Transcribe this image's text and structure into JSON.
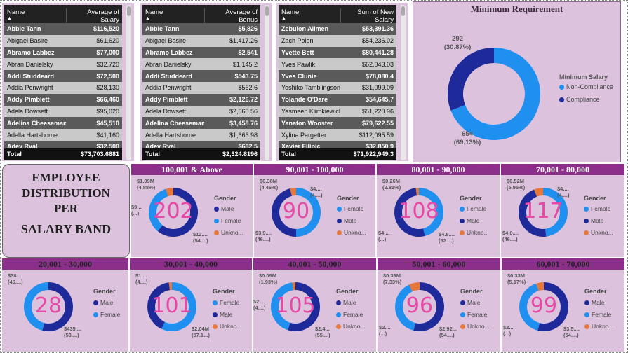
{
  "colors": {
    "male": "#1e2a9a",
    "female": "#1f8ff0",
    "unknown": "#e8773a",
    "compliance": "#1e2a9a",
    "noncompliance": "#1f8ff0"
  },
  "tables": [
    {
      "col1": "Name",
      "col2": "Average of Salary",
      "total_label": "Total",
      "total": "$73,703.6681",
      "rows": [
        [
          "Abbie Tann",
          "$116,520"
        ],
        [
          "Abigael Basire",
          "$61,620"
        ],
        [
          "Abramo Labbez",
          "$77,000"
        ],
        [
          "Abran Danielsky",
          "$32,720"
        ],
        [
          "Addi Studdeard",
          "$72,500"
        ],
        [
          "Addia Penwright",
          "$28,130"
        ],
        [
          "Addy Pimblett",
          "$66,460"
        ],
        [
          "Adela Dowsett",
          "$95,020"
        ],
        [
          "Adelina Cheeseman",
          "$45,510"
        ],
        [
          "Adella Hartshorne",
          "$41,160"
        ],
        [
          "Adey Ryal",
          "$32,500"
        ]
      ]
    },
    {
      "col1": "Name",
      "col2": "Average of Bonus",
      "total_label": "Total",
      "total": "$2,324.8196",
      "rows": [
        [
          "Abbie Tann",
          "$5,826"
        ],
        [
          "Abigael Basire",
          "$1,417.26"
        ],
        [
          "Abramo Labbez",
          "$2,541"
        ],
        [
          "Abran Danielsky",
          "$1,145.2"
        ],
        [
          "Addi Studdeard",
          "$543.75"
        ],
        [
          "Addia Penwright",
          "$562.6"
        ],
        [
          "Addy Pimblett",
          "$2,126.72"
        ],
        [
          "Adela Dowsett",
          "$2,660.56"
        ],
        [
          "Adelina Cheeseman",
          "$3,458.76"
        ],
        [
          "Adella Hartshorne",
          "$1,666.98"
        ],
        [
          "Adey Ryal",
          "$682.5"
        ]
      ]
    },
    {
      "col1": "Name",
      "col2": "Sum of New Salary",
      "total_label": "Total",
      "total": "$71,922,949.3",
      "rows": [
        [
          "Zebulon Allmen",
          "$53,391.36"
        ],
        [
          "Zach Polon",
          "$54,236.02"
        ],
        [
          "Yvette Bett",
          "$80,441.28"
        ],
        [
          "Yves Pawlik",
          "$62,043.03"
        ],
        [
          "Yves Clunie",
          "$78,080.4"
        ],
        [
          "Yoshiko Tamblingson",
          "$31,099.09"
        ],
        [
          "Yolande O'Dare",
          "$54,645.7"
        ],
        [
          "Yasmeen Klimkiewich",
          "$51,220.96"
        ],
        [
          "Yanaton Wooster",
          "$79,622.55"
        ],
        [
          "Xylina Pargetter",
          "$112,095.59"
        ],
        [
          "Xavier Filipic",
          "$32,850.9"
        ]
      ]
    }
  ],
  "min_requirement": {
    "title": "Minimum Requirement",
    "legend_title": "Minimum Salary",
    "legend": [
      "Non-Compliance",
      "Compliance"
    ],
    "label_compliance": [
      "292",
      "(30.87%)"
    ],
    "label_noncompliance": [
      "654",
      "(69.13%)"
    ]
  },
  "employee_dist": {
    "line1": "EMPLOYEE",
    "line2": "DISTRIBUTION",
    "line3": "PER",
    "line4": "SALARY BAND"
  },
  "chart_data": [
    {
      "type": "pie",
      "title": "Minimum Requirement",
      "legend_title": "Minimum Salary",
      "categories": [
        "Compliance",
        "Non-Compliance"
      ],
      "values": [
        292,
        654
      ],
      "percent": [
        30.87,
        69.13
      ]
    },
    {
      "type": "pie",
      "title": "100,001 & Above",
      "count": 202,
      "categories": [
        "Male",
        "Female",
        "Unknown"
      ],
      "values": [
        0.61,
        0.34,
        0.05
      ]
    },
    {
      "type": "pie",
      "title": "90,001 - 100,000",
      "count": 90,
      "categories": [
        "Female",
        "Male",
        "Unknown"
      ],
      "values": [
        0.5,
        0.46,
        0.04
      ]
    },
    {
      "type": "pie",
      "title": "80,001 - 90,000",
      "count": 108,
      "categories": [
        "Female",
        "Male",
        "Unknown"
      ],
      "values": [
        0.46,
        0.52,
        0.02
      ]
    },
    {
      "type": "pie",
      "title": "70,001 - 80,000",
      "count": 117,
      "categories": [
        "Female",
        "Male",
        "Unknown"
      ],
      "values": [
        0.48,
        0.46,
        0.06
      ]
    },
    {
      "type": "pie",
      "title": "20,001 - 30,000",
      "count": 28,
      "categories": [
        "Male",
        "Female"
      ],
      "values": [
        0.54,
        0.46
      ]
    },
    {
      "type": "pie",
      "title": "30,001 - 40,000",
      "count": 101,
      "categories": [
        "Female",
        "Male",
        "Unknown"
      ],
      "values": [
        0.57,
        0.41,
        0.02
      ]
    },
    {
      "type": "pie",
      "title": "40,001 - 50,000",
      "count": 105,
      "categories": [
        "Male",
        "Female",
        "Unknown"
      ],
      "values": [
        0.55,
        0.43,
        0.02
      ]
    },
    {
      "type": "pie",
      "title": "50,001 - 60,000",
      "count": 96,
      "categories": [
        "Male",
        "Female",
        "Unknown"
      ],
      "values": [
        0.54,
        0.39,
        0.07
      ]
    },
    {
      "type": "pie",
      "title": "60,001 - 70,000",
      "count": 99,
      "categories": [
        "Male",
        "Female",
        "Unknown"
      ],
      "values": [
        0.54,
        0.41,
        0.05
      ]
    }
  ],
  "bands": [
    {
      "title": "100,001 & Above",
      "count": "202",
      "legend": [
        "Male",
        "Female",
        "Unkno..."
      ],
      "legend_title": "Gender",
      "labels": [
        {
          "t": "$1.09M",
          "pos": "tl1"
        },
        {
          "t": "(4.88%)",
          "pos": "tl2"
        },
        {
          "t": "$9...",
          "pos": "l1"
        },
        {
          "t": "(...)",
          "pos": "l2"
        },
        {
          "t": "$12....",
          "pos": "br1"
        },
        {
          "t": "(54....)",
          "pos": "br2"
        }
      ],
      "segments": [
        [
          "male",
          0.61
        ],
        [
          "female",
          0.34
        ],
        [
          "unknown",
          0.05
        ]
      ]
    },
    {
      "title": "90,001 - 100,000",
      "count": "90",
      "legend": [
        "Female",
        "Male",
        "Unkno..."
      ],
      "legend_title": "Gender",
      "labels": [
        {
          "t": "$0.38M",
          "pos": "tl1"
        },
        {
          "t": "(4.46%)",
          "pos": "tl2"
        },
        {
          "t": "$4....",
          "pos": "tr1"
        },
        {
          "t": "(4....)",
          "pos": "tr2"
        },
        {
          "t": "$3.9....",
          "pos": "bl1"
        },
        {
          "t": "(46....)",
          "pos": "bl2"
        }
      ],
      "segments": [
        [
          "female",
          0.5
        ],
        [
          "male",
          0.46
        ],
        [
          "unknown",
          0.04
        ]
      ]
    },
    {
      "title": "80,001 - 90,000",
      "count": "108",
      "legend": [
        "Female",
        "Male",
        "Unkno..."
      ],
      "legend_title": "Gender",
      "labels": [
        {
          "t": "$0.26M",
          "pos": "tl1"
        },
        {
          "t": "(2.81%)",
          "pos": "tl2"
        },
        {
          "t": "$4....",
          "pos": "bl1"
        },
        {
          "t": "(...)",
          "pos": "bl2"
        },
        {
          "t": "$4.8....",
          "pos": "br1"
        },
        {
          "t": "(52....)",
          "pos": "br2"
        }
      ],
      "segments": [
        [
          "female",
          0.46
        ],
        [
          "male",
          0.52
        ],
        [
          "unknown",
          0.02
        ]
      ]
    },
    {
      "title": "70,001 - 80,000",
      "count": "117",
      "legend": [
        "Female",
        "Male",
        "Unkno..."
      ],
      "legend_title": "Gender",
      "labels": [
        {
          "t": "$0.52M",
          "pos": "tl1"
        },
        {
          "t": "(5.95%)",
          "pos": "tl2"
        },
        {
          "t": "$4....",
          "pos": "tr1"
        },
        {
          "t": "(4....)",
          "pos": "tr2"
        },
        {
          "t": "$4.0....",
          "pos": "bl1"
        },
        {
          "t": "(46....)",
          "pos": "bl2"
        }
      ],
      "segments": [
        [
          "female",
          0.48
        ],
        [
          "male",
          0.46
        ],
        [
          "unknown",
          0.06
        ]
      ]
    },
    {
      "title": "20,001 - 30,000",
      "count": "28",
      "legend": [
        "Male",
        "Female"
      ],
      "legend_title": "Gender",
      "labels": [
        {
          "t": "$38...",
          "pos": "tl1"
        },
        {
          "t": "(46....)",
          "pos": "tl2"
        },
        {
          "t": "$435....",
          "pos": "br1"
        },
        {
          "t": "(53....)",
          "pos": "br2"
        }
      ],
      "segments": [
        [
          "male",
          0.54
        ],
        [
          "female",
          0.46
        ]
      ]
    },
    {
      "title": "30,001 - 40,000",
      "count": "101",
      "legend": [
        "Female",
        "Male",
        "Unkno..."
      ],
      "legend_title": "Gender",
      "labels": [
        {
          "t": "$1....",
          "pos": "tl1"
        },
        {
          "t": "(4....)",
          "pos": "tl2"
        },
        {
          "t": "$2.04M",
          "pos": "br1"
        },
        {
          "t": "(57.1...)",
          "pos": "br2"
        }
      ],
      "segments": [
        [
          "female",
          0.57
        ],
        [
          "male",
          0.41
        ],
        [
          "unknown",
          0.02
        ]
      ]
    },
    {
      "title": "40,001 - 50,000",
      "count": "105",
      "legend": [
        "Male",
        "Female",
        "Unkno..."
      ],
      "legend_title": "Gender",
      "labels": [
        {
          "t": "$0.09M",
          "pos": "tl1"
        },
        {
          "t": "(1.93%)",
          "pos": "tl2"
        },
        {
          "t": "$2....",
          "pos": "l1"
        },
        {
          "t": "(4....)",
          "pos": "l2"
        },
        {
          "t": "$2.4...",
          "pos": "br1"
        },
        {
          "t": "(55....)",
          "pos": "br2"
        }
      ],
      "segments": [
        [
          "male",
          0.55
        ],
        [
          "female",
          0.43
        ],
        [
          "unknown",
          0.02
        ]
      ]
    },
    {
      "title": "50,001 - 60,000",
      "count": "96",
      "legend": [
        "Male",
        "Female",
        "Unkno..."
      ],
      "legend_title": "Gender",
      "labels": [
        {
          "t": "$0.39M",
          "pos": "tl1"
        },
        {
          "t": "(7.33%)",
          "pos": "tl2"
        },
        {
          "t": "$2....",
          "pos": "bl1"
        },
        {
          "t": "(...)",
          "pos": "bl2"
        },
        {
          "t": "$2.92...",
          "pos": "br1"
        },
        {
          "t": "(54....)",
          "pos": "br2"
        }
      ],
      "segments": [
        [
          "male",
          0.54
        ],
        [
          "female",
          0.39
        ],
        [
          "unknown",
          0.07
        ]
      ]
    },
    {
      "title": "60,001 - 70,000",
      "count": "99",
      "legend": [
        "Male",
        "Female",
        "Unkno..."
      ],
      "legend_title": "Gender",
      "labels": [
        {
          "t": "$0.33M",
          "pos": "tl1"
        },
        {
          "t": "(5.17%)",
          "pos": "tl2"
        },
        {
          "t": "$2....",
          "pos": "bl1"
        },
        {
          "t": "(...)",
          "pos": "bl2"
        },
        {
          "t": "$3.5....",
          "pos": "br1"
        },
        {
          "t": "(54....)",
          "pos": "br2"
        }
      ],
      "segments": [
        [
          "male",
          0.54
        ],
        [
          "female",
          0.41
        ],
        [
          "unknown",
          0.05
        ]
      ]
    }
  ]
}
